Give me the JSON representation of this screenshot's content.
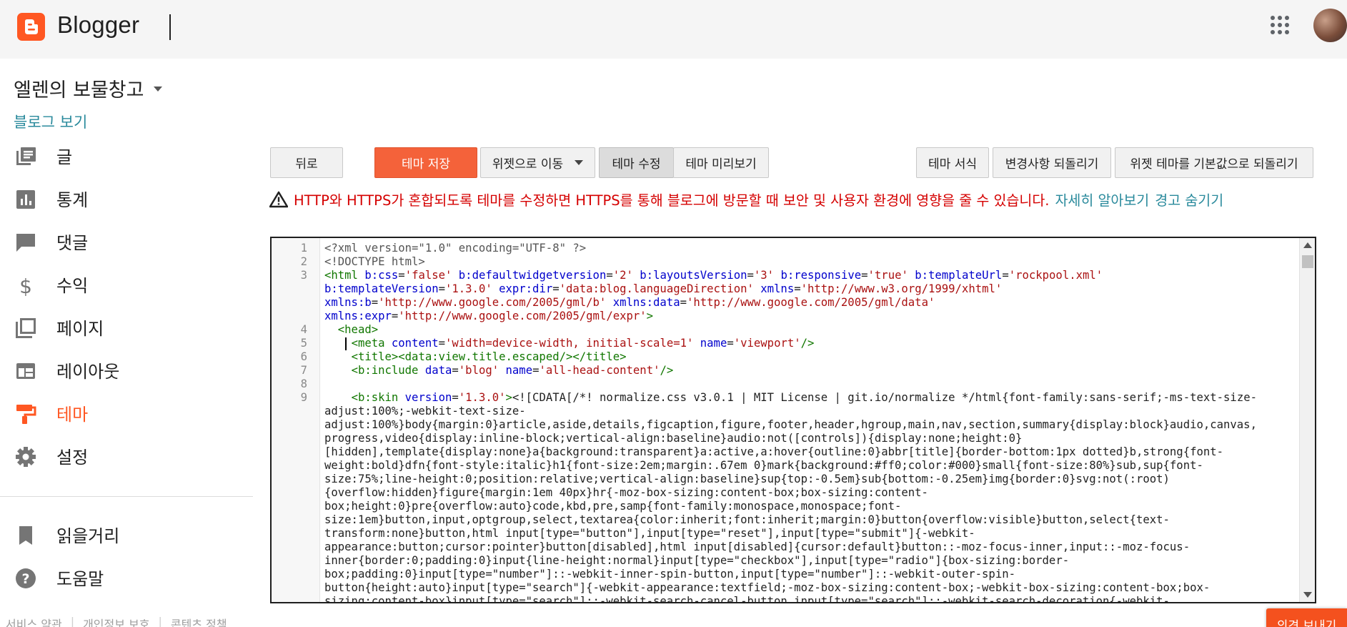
{
  "app": {
    "title": "Blogger"
  },
  "blog": {
    "name": "엘렌의 보물창고",
    "view_link": "블로그 보기"
  },
  "sidebar": {
    "items": [
      {
        "label": "글",
        "icon": "posts-icon"
      },
      {
        "label": "통계",
        "icon": "stats-icon"
      },
      {
        "label": "댓글",
        "icon": "comments-icon"
      },
      {
        "label": "수익",
        "icon": "earnings-icon"
      },
      {
        "label": "페이지",
        "icon": "pages-icon"
      },
      {
        "label": "레이아웃",
        "icon": "layout-icon"
      },
      {
        "label": "테마",
        "icon": "theme-icon",
        "active": true
      },
      {
        "label": "설정",
        "icon": "settings-icon"
      }
    ],
    "secondary": [
      {
        "label": "읽을거리",
        "icon": "bookmark-icon"
      },
      {
        "label": "도움말",
        "icon": "help-icon"
      }
    ],
    "footer_links": [
      "서비스 약관",
      "개인정보 보호",
      "콘텐츠 정책"
    ]
  },
  "toolbar": {
    "back": "뒤로",
    "save_theme": "테마 저장",
    "jump_to_widget": "위젯으로 이동",
    "edit_theme": "테마 수정",
    "preview_theme": "테마 미리보기",
    "format_theme": "테마 서식",
    "revert_changes": "변경사항 되돌리기",
    "reset_widgets": "위젯 테마를 기본값으로 되돌리기"
  },
  "warning": {
    "text": "HTTP와 HTTPS가 혼합되도록 테마를 수정하면 HTTPS를 통해 블로그에 방문할 때 보안 및 사용자 환경에 영향을 줄 수 있습니다.",
    "learn_more": "자세히 알아보기",
    "hide": "경고 숨기기"
  },
  "code_lines": [
    {
      "n": "1",
      "parts": [
        [
          "meta",
          "<?xml version=\"1.0\" encoding=\"UTF-8\" ?>"
        ]
      ]
    },
    {
      "n": "2",
      "parts": [
        [
          "meta",
          "<!DOCTYPE html>"
        ]
      ]
    },
    {
      "n": "3",
      "parts": [
        [
          "tag",
          "<html "
        ],
        [
          "attr",
          "b:css"
        ],
        [
          "plain",
          "="
        ],
        [
          "val",
          "'false'"
        ],
        [
          "plain",
          " "
        ],
        [
          "attr",
          "b:defaultwidgetversion"
        ],
        [
          "plain",
          "="
        ],
        [
          "val",
          "'2'"
        ],
        [
          "plain",
          " "
        ],
        [
          "attr",
          "b:layoutsVersion"
        ],
        [
          "plain",
          "="
        ],
        [
          "val",
          "'3'"
        ],
        [
          "plain",
          " "
        ],
        [
          "attr",
          "b:responsive"
        ],
        [
          "plain",
          "="
        ],
        [
          "val",
          "'true'"
        ],
        [
          "plain",
          " "
        ],
        [
          "attr",
          "b:templateUrl"
        ],
        [
          "plain",
          "="
        ],
        [
          "val",
          "'rockpool.xml'"
        ]
      ]
    },
    {
      "n": "",
      "parts": [
        [
          "attr",
          "b:templateVersion"
        ],
        [
          "plain",
          "="
        ],
        [
          "val",
          "'1.3.0'"
        ],
        [
          "plain",
          " "
        ],
        [
          "attr",
          "expr:dir"
        ],
        [
          "plain",
          "="
        ],
        [
          "val",
          "'data:blog.languageDirection'"
        ],
        [
          "plain",
          " "
        ],
        [
          "attr",
          "xmlns"
        ],
        [
          "plain",
          "="
        ],
        [
          "val",
          "'http://www.w3.org/1999/xhtml'"
        ]
      ]
    },
    {
      "n": "",
      "parts": [
        [
          "attr",
          "xmlns:b"
        ],
        [
          "plain",
          "="
        ],
        [
          "val",
          "'http://www.google.com/2005/gml/b'"
        ],
        [
          "plain",
          " "
        ],
        [
          "attr",
          "xmlns:data"
        ],
        [
          "plain",
          "="
        ],
        [
          "val",
          "'http://www.google.com/2005/gml/data'"
        ]
      ]
    },
    {
      "n": "",
      "parts": [
        [
          "attr",
          "xmlns:expr"
        ],
        [
          "plain",
          "="
        ],
        [
          "val",
          "'http://www.google.com/2005/gml/expr'"
        ],
        [
          "tag",
          ">"
        ]
      ]
    },
    {
      "n": "4",
      "parts": [
        [
          "plain",
          "  "
        ],
        [
          "tag",
          "<head>"
        ]
      ]
    },
    {
      "n": "5",
      "parts": [
        [
          "plain",
          "    "
        ],
        [
          "tag",
          "<meta "
        ],
        [
          "attr",
          "content"
        ],
        [
          "plain",
          "="
        ],
        [
          "val",
          "'width=device-width, initial-scale=1'"
        ],
        [
          "plain",
          " "
        ],
        [
          "attr",
          "name"
        ],
        [
          "plain",
          "="
        ],
        [
          "val",
          "'viewport'"
        ],
        [
          "tag",
          "/>"
        ]
      ]
    },
    {
      "n": "6",
      "parts": [
        [
          "plain",
          "    "
        ],
        [
          "tag",
          "<title><data:view.title.escaped/></title>"
        ]
      ]
    },
    {
      "n": "7",
      "parts": [
        [
          "plain",
          "    "
        ],
        [
          "tag",
          "<b:include "
        ],
        [
          "attr",
          "data"
        ],
        [
          "plain",
          "="
        ],
        [
          "val",
          "'blog'"
        ],
        [
          "plain",
          " "
        ],
        [
          "attr",
          "name"
        ],
        [
          "plain",
          "="
        ],
        [
          "val",
          "'all-head-content'"
        ],
        [
          "tag",
          "/>"
        ]
      ]
    },
    {
      "n": "8",
      "parts": [
        [
          "plain",
          ""
        ]
      ]
    },
    {
      "n": "9",
      "parts": [
        [
          "plain",
          "    "
        ],
        [
          "tag",
          "<b:skin "
        ],
        [
          "attr",
          "version"
        ],
        [
          "plain",
          "="
        ],
        [
          "val",
          "'1.3.0'"
        ],
        [
          "tag",
          ">"
        ],
        [
          "cdata",
          "<![CDATA[/*! normalize.css v3.0.1 | MIT License | git.io/normalize */html{font-family:sans-serif;-ms-text-size-"
        ]
      ]
    },
    {
      "n": "",
      "parts": [
        [
          "cdata",
          "adjust:100%;-webkit-text-size-"
        ]
      ]
    },
    {
      "n": "",
      "parts": [
        [
          "cdata",
          "adjust:100%}body{margin:0}article,aside,details,figcaption,figure,footer,header,hgroup,main,nav,section,summary{display:block}audio,canvas,"
        ]
      ]
    },
    {
      "n": "",
      "parts": [
        [
          "cdata",
          "progress,video{display:inline-block;vertical-align:baseline}audio:not([controls]){display:none;height:0}"
        ]
      ]
    },
    {
      "n": "",
      "parts": [
        [
          "cdata",
          "[hidden],template{display:none}a{background:transparent}a:active,a:hover{outline:0}abbr[title]{border-bottom:1px dotted}b,strong{font-"
        ]
      ]
    },
    {
      "n": "",
      "parts": [
        [
          "cdata",
          "weight:bold}dfn{font-style:italic}h1{font-size:2em;margin:.67em 0}mark{background:#ff0;color:#000}small{font-size:80%}sub,sup{font-"
        ]
      ]
    },
    {
      "n": "",
      "parts": [
        [
          "cdata",
          "size:75%;line-height:0;position:relative;vertical-align:baseline}sup{top:-0.5em}sub{bottom:-0.25em}img{border:0}svg:not(:root)"
        ]
      ]
    },
    {
      "n": "",
      "parts": [
        [
          "cdata",
          "{overflow:hidden}figure{margin:1em 40px}hr{-moz-box-sizing:content-box;box-sizing:content-"
        ]
      ]
    },
    {
      "n": "",
      "parts": [
        [
          "cdata",
          "box;height:0}pre{overflow:auto}code,kbd,pre,samp{font-family:monospace,monospace;font-"
        ]
      ]
    },
    {
      "n": "",
      "parts": [
        [
          "cdata",
          "size:1em}button,input,optgroup,select,textarea{color:inherit;font:inherit;margin:0}button{overflow:visible}button,select{text-"
        ]
      ]
    },
    {
      "n": "",
      "parts": [
        [
          "cdata",
          "transform:none}button,html input[type=\"button\"],input[type=\"reset\"],input[type=\"submit\"]{-webkit-"
        ]
      ]
    },
    {
      "n": "",
      "parts": [
        [
          "cdata",
          "appearance:button;cursor:pointer}button[disabled],html input[disabled]{cursor:default}button::-moz-focus-inner,input::-moz-focus-"
        ]
      ]
    },
    {
      "n": "",
      "parts": [
        [
          "cdata",
          "inner{border:0;padding:0}input{line-height:normal}input[type=\"checkbox\"],input[type=\"radio\"]{box-sizing:border-"
        ]
      ]
    },
    {
      "n": "",
      "parts": [
        [
          "cdata",
          "box;padding:0}input[type=\"number\"]::-webkit-inner-spin-button,input[type=\"number\"]::-webkit-outer-spin-"
        ]
      ]
    },
    {
      "n": "",
      "parts": [
        [
          "cdata",
          "button{height:auto}input[type=\"search\"]{-webkit-appearance:textfield;-moz-box-sizing:content-box;-webkit-box-sizing:content-box;box-"
        ]
      ]
    },
    {
      "n": "",
      "parts": [
        [
          "cdata",
          "sizing:content-box}input[type=\"search\"]::-webkit-search-cancel-button,input[type=\"search\"]::-webkit-search-decoration{-webkit-"
        ]
      ]
    }
  ],
  "feedback": {
    "label": "의견 보내기"
  },
  "colors": {
    "brand": "#ff5722",
    "accent_link": "#2a8a9c",
    "warning": "#d50000",
    "primary_button": "#f4623a"
  }
}
